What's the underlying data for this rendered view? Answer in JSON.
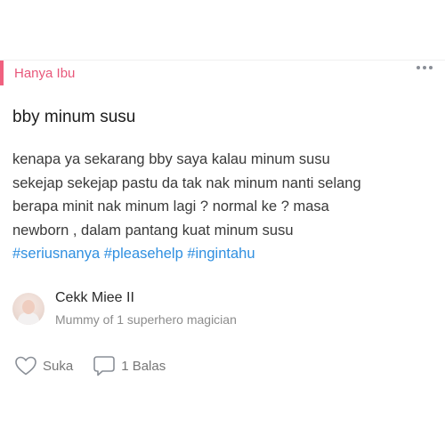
{
  "category": {
    "label": "Hanya Ibu",
    "accent_color": "#f0617f"
  },
  "more_icon": "ellipsis-icon",
  "post": {
    "title": "bby minum susu",
    "body_lines": [
      "kenapa ya sekarang bby saya kalau minum susu",
      "sekejap sekejap pastu da tak nak minum nanti selang",
      "berapa minit nak minum lagi ? normal ke ? masa",
      "newborn , dalam pantang kuat minum susu"
    ],
    "tags": [
      "#seriusnanya",
      "#pleasehelp",
      "#ingintahu"
    ],
    "tag_color": "#2f8fe0"
  },
  "author": {
    "name": "Cekk Miee II",
    "description": "Mummy of 1 superhero magician"
  },
  "actions": {
    "like_label": "Suka",
    "like_icon": "heart-icon",
    "reply_label": "1 Balas",
    "reply_icon": "comment-bubble-icon"
  }
}
